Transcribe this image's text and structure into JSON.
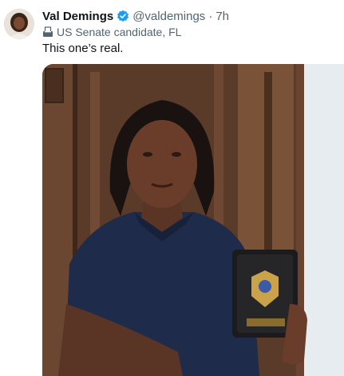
{
  "tweet": {
    "author_name": "Val Demings",
    "handle": "@valdemings",
    "separator": "·",
    "time": "7h",
    "label_text": "US Senate candidate, FL",
    "text": "This one’s real."
  },
  "icons": {
    "verified": "verified-badge-icon",
    "label": "ballot-box-icon"
  },
  "colors": {
    "verified": "#1d9bf0",
    "secondary_text": "#536471",
    "primary_text": "#0f1419"
  }
}
